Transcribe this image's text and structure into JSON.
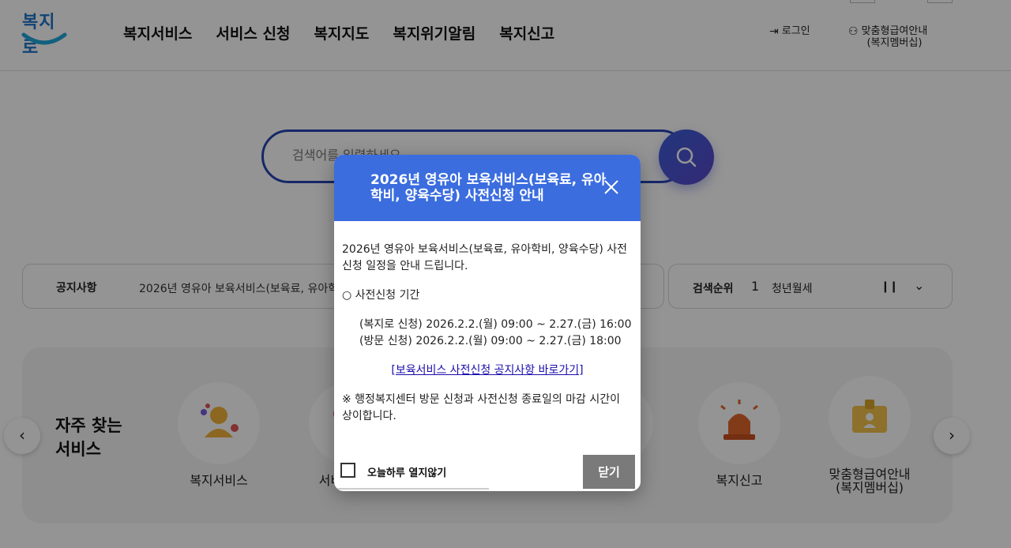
{
  "header": {
    "logo_text": "복지로",
    "nav": [
      "복지서비스",
      "서비스 신청",
      "복지지도",
      "복지위기알림",
      "복지신고"
    ],
    "login_label": "로그인",
    "member_label": "맞춤형급여안내\n(복지멤버십)"
  },
  "search": {
    "placeholder": "검색어를 입력하세요"
  },
  "notice": {
    "title": "공지사항",
    "text": "2026년 영유아 보육서비스(보육료, 유아학"
  },
  "rank": {
    "title": "검색순위",
    "number": "1",
    "keyword": "청년월세"
  },
  "services": {
    "title": "자주 찾는\n서비스",
    "items": [
      {
        "label": "복지서비스",
        "icon": "person-icon"
      },
      {
        "label": "서비스 신청",
        "icon": "application-icon"
      },
      {
        "label": "",
        "icon": "map-icon"
      },
      {
        "label": "",
        "icon": "alert-icon"
      },
      {
        "label": "복지신고",
        "icon": "siren-icon"
      },
      {
        "label": "맞춤형급여안내\n(복지멤버십)",
        "icon": "badge-icon"
      }
    ]
  },
  "modal": {
    "title": "2026년 영유아 보육서비스(보육료, 유아학비, 양육수당) 사전신청 안내",
    "intro": "2026년 영유아 보육서비스(보육료, 유아학비, 양육수당) 사전신청 일정을 안내 드립니다.",
    "period_heading": "○ 사전신청 기간",
    "period_online": "(복지로 신청) 2026.2.2.(월) 09:00 ~ 2.27.(금) 16:00",
    "period_visit": "(방문 신청) 2026.2.2.(월) 09:00 ~ 2.27.(금) 18:00",
    "link_text": "[보육서비스 사전신청 공지사항 바로가기]",
    "note": "※ 행정복지센터 방문 신청과 사전신청 종료일의 마감 시간이 상이합니다.",
    "checkbox_label": "오늘하루 열지않기",
    "close_label": "닫기"
  },
  "colors": {
    "brand_blue": "#3b6ddf",
    "search_border": "#2745b4"
  }
}
